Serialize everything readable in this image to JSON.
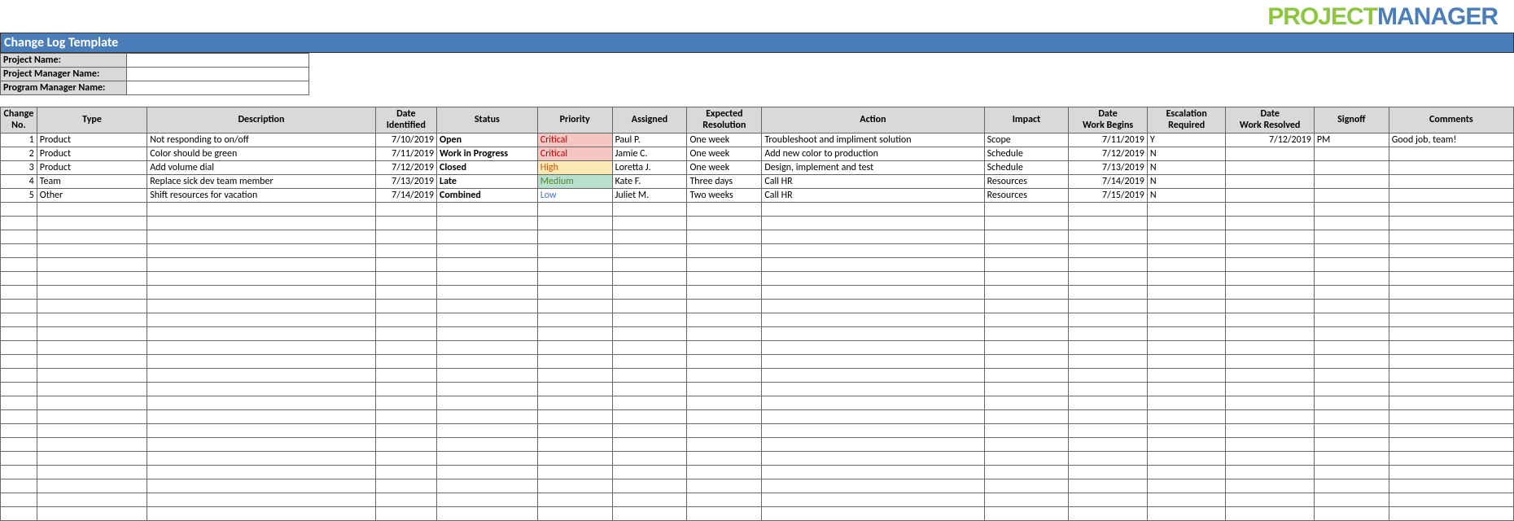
{
  "logo": {
    "part1": "PROJECT",
    "part2": "MANAGER"
  },
  "title": "Change Log Template",
  "meta": {
    "projectName": {
      "label": "Project Name:",
      "value": ""
    },
    "projectManager": {
      "label": "Project Manager Name:",
      "value": ""
    },
    "programManager": {
      "label": "Program Manager Name:",
      "value": ""
    }
  },
  "headers": {
    "no": "Change No.",
    "type": "Type",
    "description": "Description",
    "dateIdentified": "Date Identified",
    "status": "Status",
    "priority": "Priority",
    "assigned": "Assigned",
    "expected": "Expected Resolution",
    "action": "Action",
    "impact": "Impact",
    "workBegins": "Date Work Begins",
    "escalation": "Escalation Required",
    "resolved": "Date Work Resolved",
    "signoff": "Signoff",
    "comments": "Comments"
  },
  "rows": [
    {
      "no": "1",
      "type": "Product",
      "description": "Not responding to on/off",
      "dateIdentified": "7/10/2019",
      "status": "Open",
      "priority": "Critical",
      "priorityClass": "p-critical",
      "assigned": "Paul P.",
      "expected": "One week",
      "action": "Troubleshoot and impliment solution",
      "impact": "Scope",
      "workBegins": "7/11/2019",
      "escalation": "Y",
      "resolved": "7/12/2019",
      "signoff": "PM",
      "comments": "Good job, team!"
    },
    {
      "no": "2",
      "type": "Product",
      "description": "Color should be green",
      "dateIdentified": "7/11/2019",
      "status": "Work in Progress",
      "priority": "Critical",
      "priorityClass": "p-critical",
      "assigned": "Jamie C.",
      "expected": "One week",
      "action": "Add new color to production",
      "impact": "Schedule",
      "workBegins": "7/12/2019",
      "escalation": "N",
      "resolved": "",
      "signoff": "",
      "comments": ""
    },
    {
      "no": "3",
      "type": "Product",
      "description": "Add volume dial",
      "dateIdentified": "7/12/2019",
      "status": "Closed",
      "priority": "High",
      "priorityClass": "p-high",
      "assigned": "Loretta J.",
      "expected": "One week",
      "action": "Design, implement and test",
      "impact": "Schedule",
      "workBegins": "7/13/2019",
      "escalation": "N",
      "resolved": "",
      "signoff": "",
      "comments": ""
    },
    {
      "no": "4",
      "type": "Team",
      "description": "Replace sick dev team member",
      "dateIdentified": "7/13/2019",
      "status": "Late",
      "priority": "Medium",
      "priorityClass": "p-medium",
      "assigned": "Kate F.",
      "expected": "Three days",
      "action": "Call HR",
      "impact": "Resources",
      "workBegins": "7/14/2019",
      "escalation": "N",
      "resolved": "",
      "signoff": "",
      "comments": ""
    },
    {
      "no": "5",
      "type": "Other",
      "description": "Shift resources for vacation",
      "dateIdentified": "7/14/2019",
      "status": "Combined",
      "priority": "Low",
      "priorityClass": "p-low",
      "assigned": "Juliet M.",
      "expected": "Two weeks",
      "action": "Call HR",
      "impact": "Resources",
      "workBegins": "7/15/2019",
      "escalation": "N",
      "resolved": "",
      "signoff": "",
      "comments": ""
    }
  ],
  "emptyRowCount": 23
}
